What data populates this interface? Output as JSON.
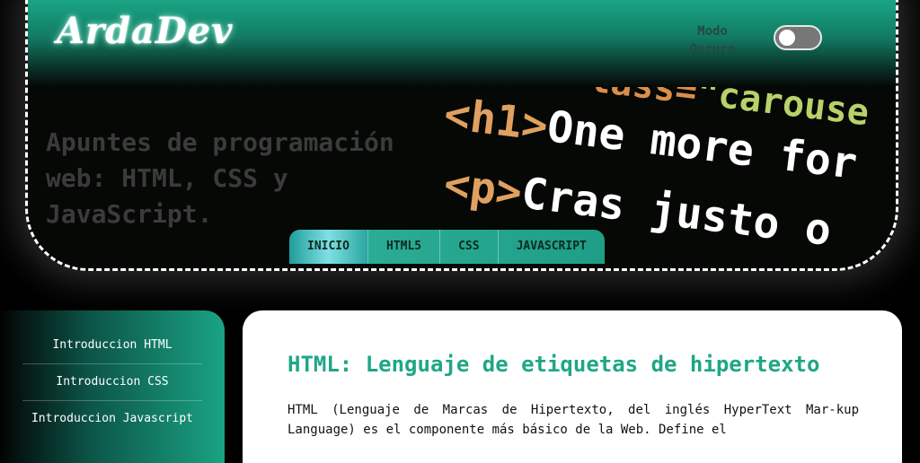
{
  "header": {
    "logo": "ArdaDev",
    "dark_mode_label_line1": "Modo",
    "dark_mode_label_line2": "Oscuro",
    "dark_mode_on": false
  },
  "hero": {
    "title": "Apuntes de programación web: HTML, CSS y JavaScript.",
    "code_lines": [
      {
        "text": "class=\"carouse",
        "color": "#d9904b"
      },
      {
        "text": "<h1>One more for",
        "color": "#ffffff"
      },
      {
        "text": "<p>Cras justo o",
        "color": "#ffffff"
      }
    ]
  },
  "tabs": [
    {
      "label": "INICIO",
      "active": true
    },
    {
      "label": "HTML5",
      "active": false
    },
    {
      "label": "CSS",
      "active": false
    },
    {
      "label": "JAVASCRIPT",
      "active": false
    }
  ],
  "sidebar": {
    "items": [
      {
        "label": "Introduccion HTML"
      },
      {
        "label": "Introduccion CSS"
      },
      {
        "label": "Introduccion Javascript"
      }
    ]
  },
  "main": {
    "heading": "HTML: Lenguaje de etiquetas de hipertexto",
    "paragraph": "HTML (Lenguaje de Marcas de Hipertexto, del inglés HyperText Mar-kup Language) es el componente más básico de la Web. Define el"
  },
  "colors": {
    "accent": "#1ea786",
    "navbar_top": "#1aa886",
    "background": "#000000"
  }
}
